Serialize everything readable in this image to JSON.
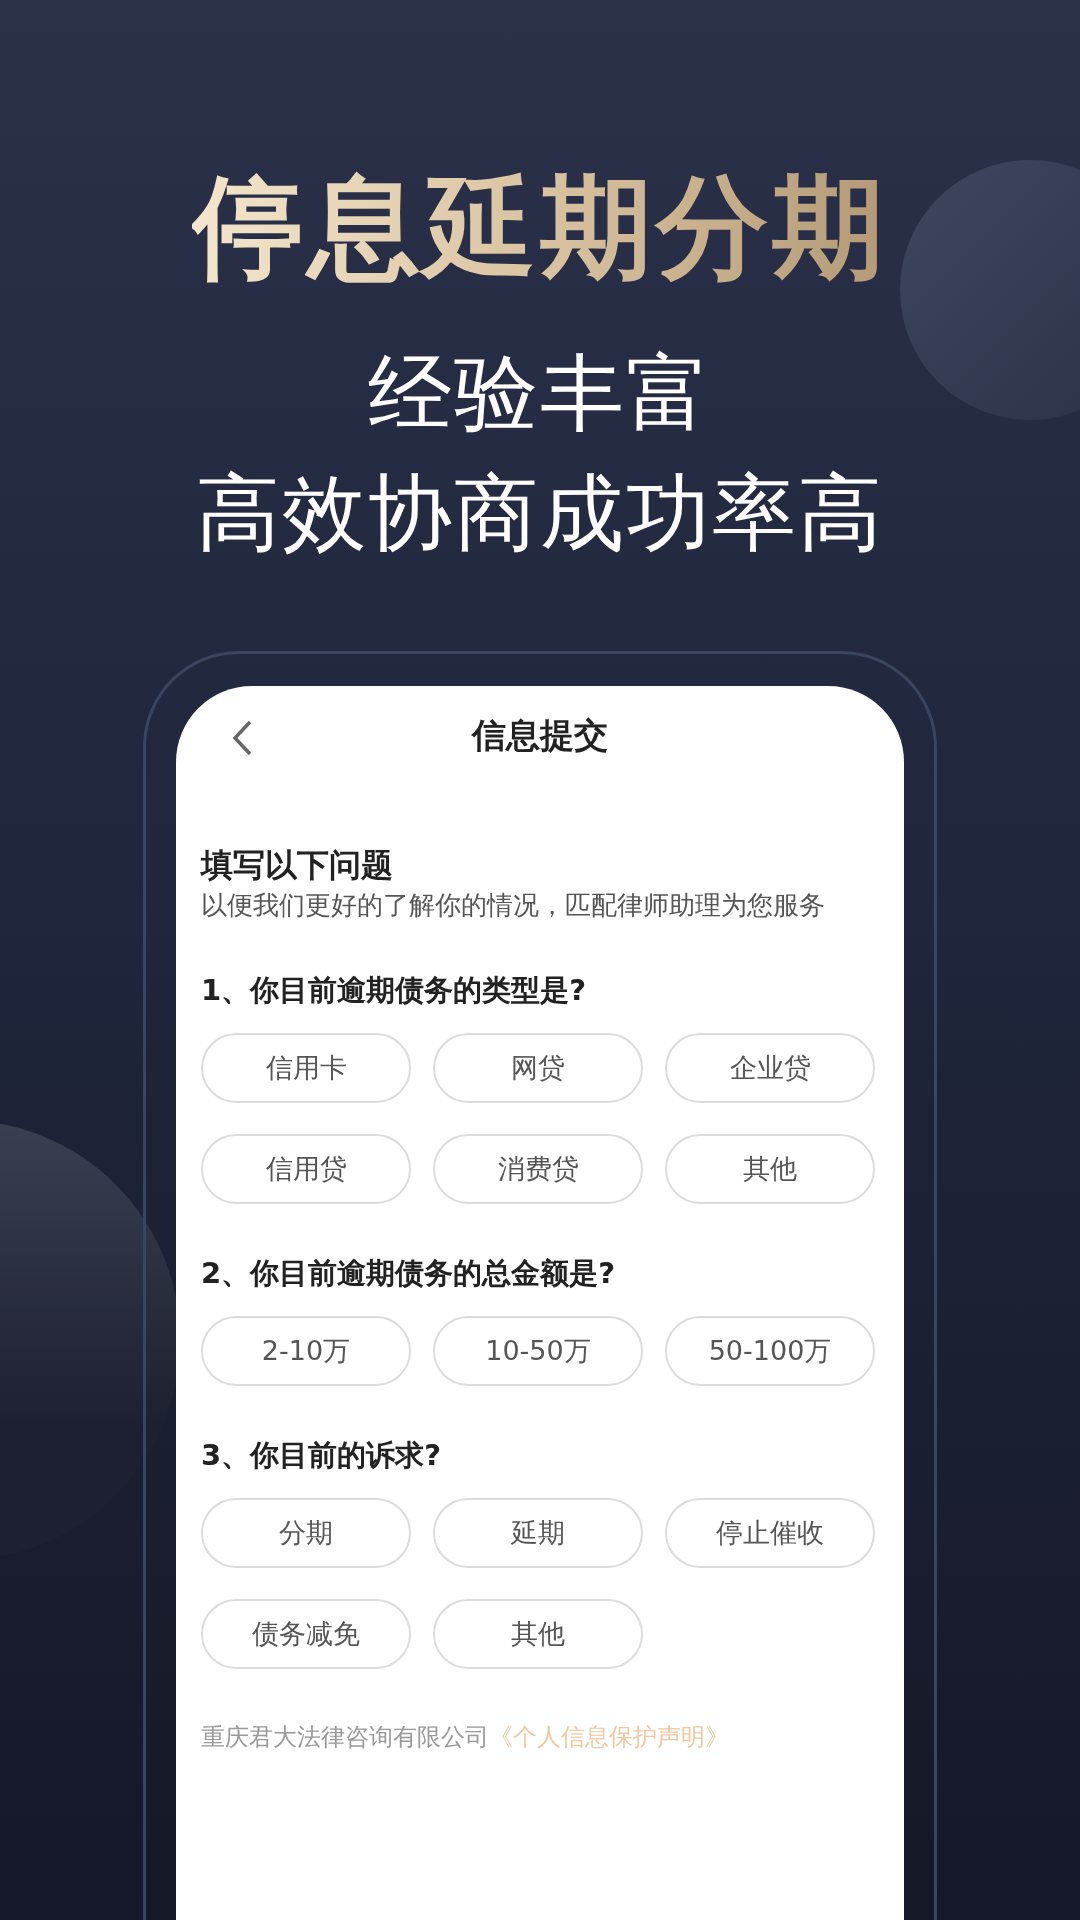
{
  "banner": {
    "headline": "停息延期分期",
    "taglines": [
      "经验丰富",
      "高效协商成功率高"
    ]
  },
  "screen": {
    "title": "信息提交",
    "intro": {
      "heading": "填写以下问题",
      "text": "以便我们更好的了解你的情况，匹配律师助理为您服务"
    },
    "questions": [
      {
        "label": "1、你目前逾期债务的类型是?",
        "options": [
          "信用卡",
          "网贷",
          "企业贷",
          "信用贷",
          "消费贷",
          "其他"
        ]
      },
      {
        "label": "2、你目前逾期债务的总金额是?",
        "options": [
          "2-10万",
          "10-50万",
          "50-100万"
        ]
      },
      {
        "label": "3、你目前的诉求?",
        "options": [
          "分期",
          "延期",
          "停止催收",
          "债务减免",
          "其他"
        ]
      }
    ],
    "footer": {
      "company": "重庆君大法律咨询有限公司",
      "link": "《个人信息保护声明》"
    }
  }
}
